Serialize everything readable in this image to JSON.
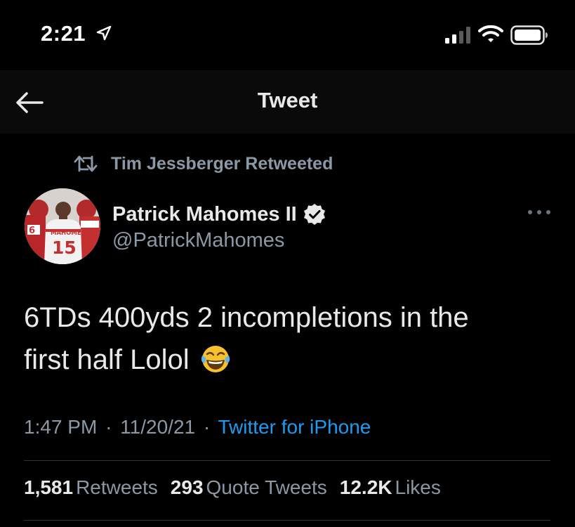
{
  "status_bar": {
    "time": "2:21",
    "icons": [
      "location-arrow-icon",
      "cellular-signal-icon",
      "wifi-icon",
      "battery-icon"
    ]
  },
  "header": {
    "title": "Tweet",
    "back_icon": "back-arrow-icon"
  },
  "retweet_context": {
    "icon": "retweet-icon",
    "text": "Tim Jessberger Retweeted"
  },
  "author": {
    "name": "Patrick Mahomes II",
    "handle": "@PatrickMahomes",
    "verified": true,
    "avatar_jersey_name": "MAHOMES",
    "avatar_jersey_number": "15"
  },
  "tweet": {
    "text_line1": "6TDs 400yds 2 incompletions in the",
    "text_line2": "first half Lolol",
    "emoji": "face-with-tears-of-joy-icon",
    "time": "1:47 PM",
    "date": "11/20/21",
    "separator": "·",
    "source": "Twitter for iPhone"
  },
  "stats": {
    "retweets_count": "1,581",
    "retweets_label": "Retweets",
    "quote_tweets_count": "293",
    "quote_tweets_label": "Quote Tweets",
    "likes_count": "12.2K",
    "likes_label": "Likes"
  },
  "colors": {
    "background": "#000000",
    "primary_text": "#e7e9ea",
    "secondary_text": "#8b98a5",
    "accent": "#1d9bf0",
    "divider": "#2f3336"
  }
}
